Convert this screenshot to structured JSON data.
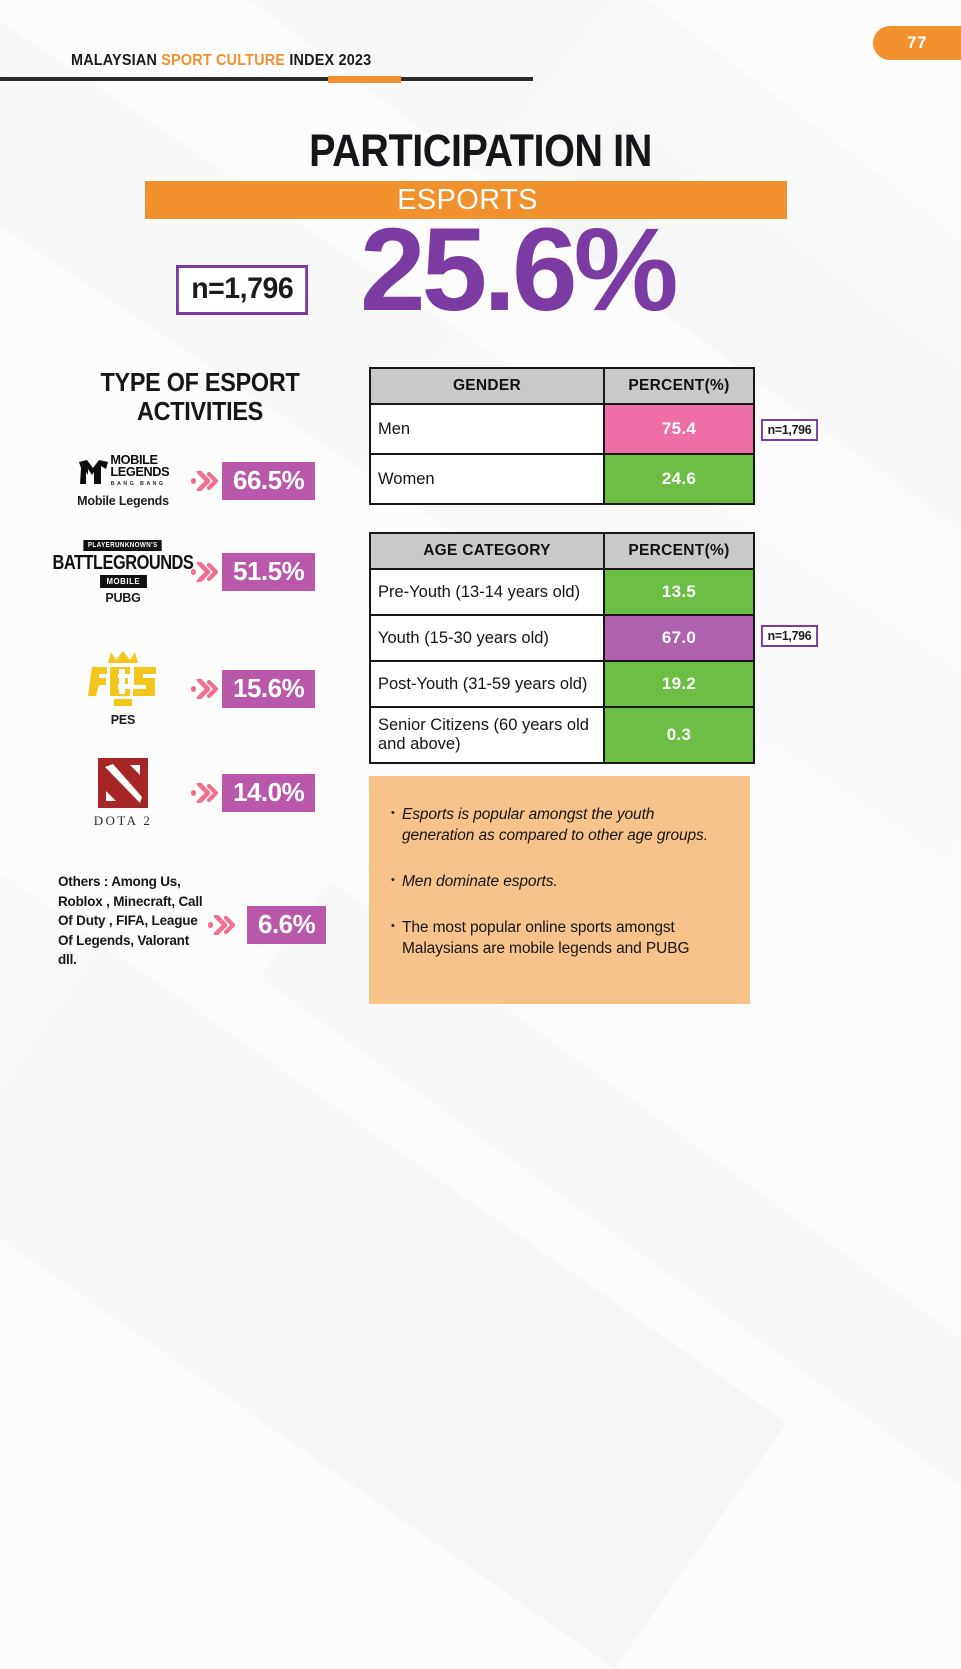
{
  "header": {
    "title_prefix": "MALAYSIAN ",
    "title_accent": "SPORT CULTURE ",
    "title_suffix": "INDEX 2023",
    "page_number": "77",
    "accent_color": "#f0912d"
  },
  "hero": {
    "title": "PARTICIPATION IN",
    "subtitle_band": "ESPORTS",
    "main_percent": "25.6%",
    "sample_size": "n=1,796",
    "purple": "#7b3ba3"
  },
  "left_panel": {
    "heading_line1": "TYPE OF ESPORT",
    "heading_line2": "ACTIVITIES",
    "activities": [
      {
        "logo": "mobile-legends-logo",
        "logo_text_1": "MOBILE",
        "logo_text_2": "LEGENDS",
        "logo_sub": "BANG BANG",
        "caption": "Mobile Legends",
        "percent": "66.5%"
      },
      {
        "logo": "pubg-mobile-logo",
        "logo_top": "PLAYERUNKNOWN'S",
        "logo_main": "BATTLEGROUNDS",
        "logo_bottom": "MOBILE",
        "caption": "PUBG",
        "percent": "51.5%"
      },
      {
        "logo": "pes-logo",
        "caption": "PES",
        "percent": "15.6%"
      },
      {
        "logo": "dota2-logo",
        "caption": "DOTA 2",
        "percent": "14.0%"
      }
    ],
    "others_label": "Others : Among Us, Roblox , Minecraft, Call Of Duty , FIFA, League Of Legends, Valorant dll.",
    "others_percent": "6.6%"
  },
  "gender_table": {
    "headers": [
      "GENDER",
      "PERCENT(%)"
    ],
    "rows": [
      {
        "label": "Men",
        "value": "75.4",
        "color": "#ee6fa5"
      },
      {
        "label": "Women",
        "value": "24.6",
        "color": "#6cbe45"
      }
    ],
    "sample_size": "n=1,796"
  },
  "age_table": {
    "headers": [
      "AGE CATEGORY",
      "PERCENT(%)"
    ],
    "rows": [
      {
        "label": "Pre-Youth (13-14 years old)",
        "value": "13.5",
        "color": "#6cbe45"
      },
      {
        "label": "Youth (15-30 years old)",
        "value": "67.0",
        "color": "#b062b0"
      },
      {
        "label": "Post-Youth (31-59 years old)",
        "value": "19.2",
        "color": "#6cbe45"
      },
      {
        "label": "Senior Citizens (60 years old and above)",
        "value": "0.3",
        "color": "#6cbe45"
      }
    ],
    "sample_size": "n=1,796"
  },
  "insights": {
    "background": "#f8c38a",
    "bullets": [
      "Esports is popular amongst the youth generation as compared to other age groups.",
      "Men dominate esports.",
      "The most popular online sports amongst Malaysians are mobile legends and PUBG"
    ]
  },
  "chart_data": {
    "type": "bar",
    "title": "Participation in Esports — Malaysian Sport Culture Index 2023",
    "overall_participation_percent": 25.6,
    "sample_size": 1796,
    "charts": [
      {
        "name": "Type of Esport Activities",
        "type": "bar",
        "categories": [
          "Mobile Legends",
          "PUBG",
          "PES",
          "DOTA 2",
          "Others (Among Us, Roblox, Minecraft, Call Of Duty, FIFA, League Of Legends, Valorant dll.)"
        ],
        "values": [
          66.5,
          51.5,
          15.6,
          14.0,
          6.6
        ],
        "ylabel": "Percent (%)",
        "ylim": [
          0,
          100
        ]
      },
      {
        "name": "Gender",
        "type": "table",
        "categories": [
          "Men",
          "Women"
        ],
        "values": [
          75.4,
          24.6
        ],
        "colors": [
          "#ee6fa5",
          "#6cbe45"
        ],
        "ylabel": "PERCENT(%)"
      },
      {
        "name": "Age Category",
        "type": "table",
        "categories": [
          "Pre-Youth (13-14 years old)",
          "Youth (15-30 years old)",
          "Post-Youth (31-59 years old)",
          "Senior Citizens (60 years old and above)"
        ],
        "values": [
          13.5,
          67.0,
          19.2,
          0.3
        ],
        "colors": [
          "#6cbe45",
          "#b062b0",
          "#6cbe45",
          "#6cbe45"
        ],
        "ylabel": "PERCENT(%)"
      }
    ]
  }
}
